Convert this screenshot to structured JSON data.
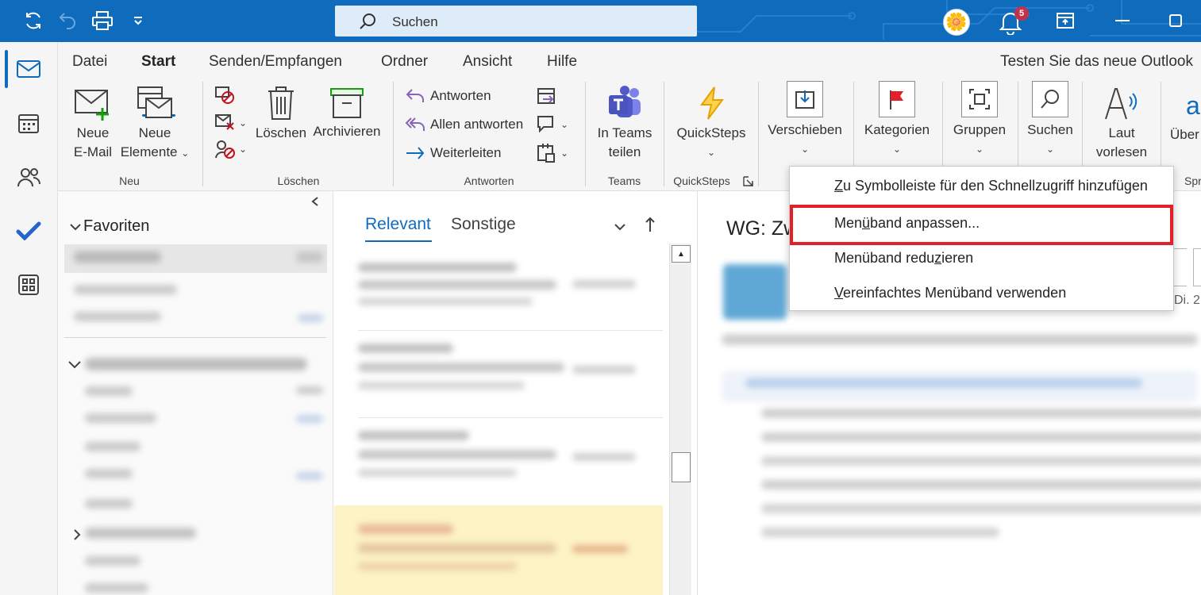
{
  "titlebar": {
    "search_placeholder": "Suchen",
    "notification_count": "5"
  },
  "ribbon": {
    "tabs": [
      "Datei",
      "Start",
      "Senden/Empfangen",
      "Ordner",
      "Ansicht",
      "Hilfe"
    ],
    "active_tab": "Start",
    "try_new_outlook": "Testen Sie das neue Outlook",
    "new_group": {
      "new_mail_line1": "Neue",
      "new_mail_line2": "E-Mail",
      "new_items_line1": "Neue",
      "new_items_line2": "Elemente",
      "label": "Neu"
    },
    "delete_group": {
      "delete": "Löschen",
      "archive": "Archivieren",
      "label": "Löschen"
    },
    "respond_group": {
      "reply": "Antworten",
      "reply_all": "Allen antworten",
      "forward": "Weiterleiten",
      "label": "Antworten"
    },
    "teams_group": {
      "line1": "In Teams",
      "line2": "teilen",
      "label": "Teams"
    },
    "quicksteps_group": {
      "button": "QuickSteps",
      "label": "QuickSteps"
    },
    "move": "Verschieben",
    "categories": "Kategorien",
    "groups": "Gruppen",
    "search": "Suchen",
    "read_aloud_line1": "Laut",
    "read_aloud_line2": "vorlesen",
    "translate_partial": "Über",
    "speech_partial": "Spr"
  },
  "folder_pane": {
    "favorites": "Favoriten"
  },
  "message_list": {
    "tab_focused": "Relevant",
    "tab_other": "Sonstige"
  },
  "reading_pane": {
    "subject_partial": "WG: Zw",
    "date_partial": "Di. 2"
  },
  "context_menu": {
    "item1_ul": "Z",
    "item1_rest": "u Symbolleiste für den Schnellzugriff hinzufügen",
    "item2_pre": "Men",
    "item2_ul": "ü",
    "item2_rest": "band anpassen...",
    "item3_pre": "Menüband redu",
    "item3_ul": "z",
    "item3_rest": "ieren",
    "item4_ul": "V",
    "item4_rest": "ereinfachtes Menüband verwenden"
  },
  "colors": {
    "brand": "#0f6cbd",
    "highlight": "#e3202a",
    "selected_row": "#fdf3c4"
  }
}
